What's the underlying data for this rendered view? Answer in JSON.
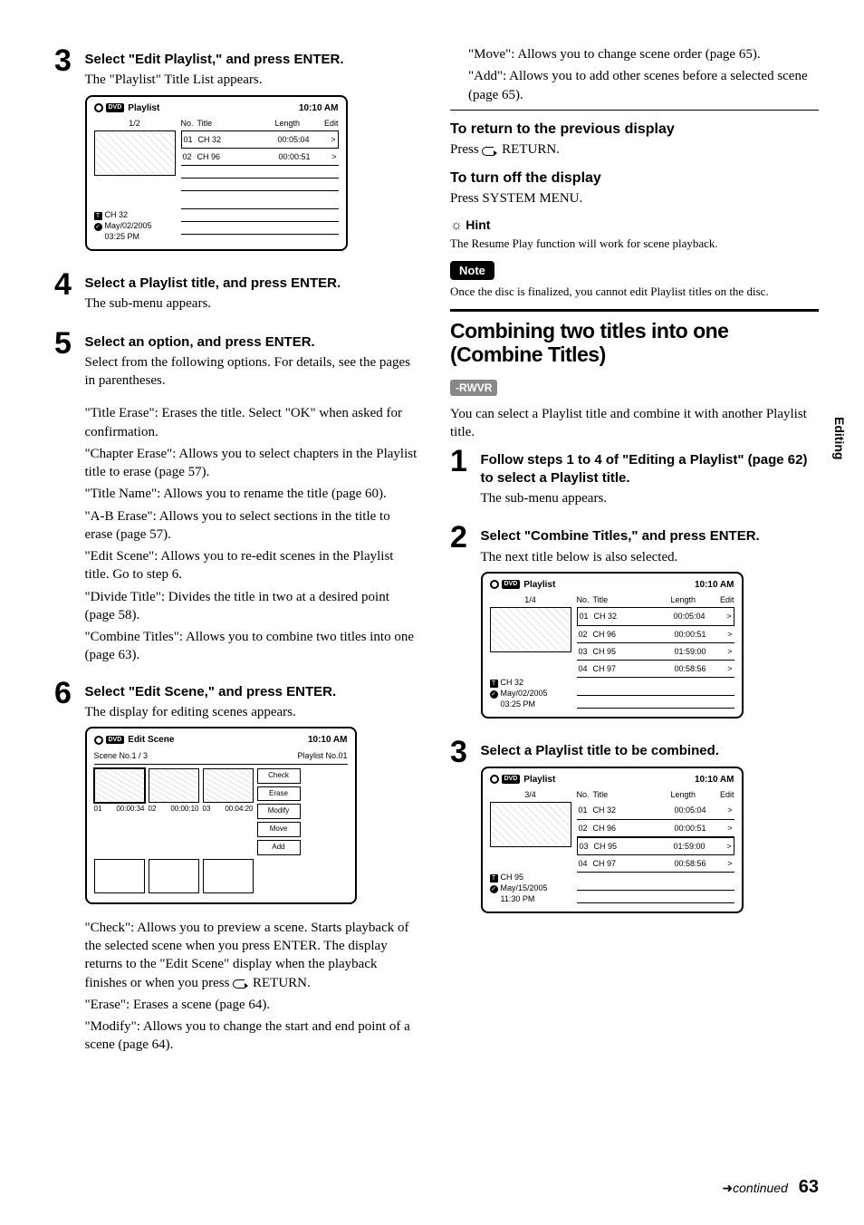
{
  "sidetab": "Editing",
  "footer": {
    "continued": "continued",
    "page": "63",
    "arrow": "➜"
  },
  "left": {
    "step3": {
      "num": "3",
      "head": "Select \"Edit Playlist,\" and press ENTER.",
      "sub": "The \"Playlist\" Title List appears."
    },
    "screen1": {
      "title": "Playlist",
      "time": "10:10 AM",
      "count": "1/2",
      "cols": [
        "No.",
        "Title",
        "Length",
        "Edit"
      ],
      "rows": [
        {
          "no": "01",
          "title": "CH 32",
          "len": "00:05:04",
          "edit": ">",
          "sel": true
        },
        {
          "no": "02",
          "title": "CH 96",
          "len": "00:00:51",
          "edit": ">"
        }
      ],
      "meta_ch": "CH 32",
      "meta_date": "May/02/2005",
      "meta_time": "03:25  PM"
    },
    "step4": {
      "num": "4",
      "head": "Select a Playlist title, and press ENTER.",
      "sub": "The sub-menu appears."
    },
    "step5": {
      "num": "5",
      "head": "Select an option, and press ENTER.",
      "sub": "Select from the following options. For details, see the pages in parentheses.",
      "opts": [
        "\"Title Erase\": Erases the title. Select \"OK\" when asked for confirmation.",
        "\"Chapter Erase\": Allows you to select chapters in the Playlist title to erase (page 57).",
        "\"Title Name\": Allows you to rename the title (page 60).",
        "\"A-B Erase\": Allows you to select sections in the title to erase (page 57).",
        "\"Edit Scene\": Allows you to re-edit scenes in the Playlist title. Go to step 6.",
        "\"Divide Title\": Divides the title in two at a desired point (page 58).",
        "\"Combine Titles\": Allows you to combine two titles into one (page 63)."
      ]
    },
    "step6": {
      "num": "6",
      "head": "Select \"Edit Scene,\" and press ENTER.",
      "sub": "The display for editing scenes appears."
    },
    "editScene": {
      "title": "Edit Scene",
      "time": "10:10 AM",
      "top_left": "Scene No.1 / 3",
      "top_right": "Playlist No.01",
      "cells": [
        {
          "no": "01",
          "t": "00:00:34",
          "sel": true
        },
        {
          "no": "02",
          "t": "00:00:10"
        },
        {
          "no": "03",
          "t": "00:04:20"
        }
      ],
      "side": [
        "Check",
        "Erase",
        "Modify",
        "Move",
        "Add"
      ]
    },
    "afterES": [
      "\"Check\": Allows you to preview a scene. Starts playback of the selected scene when you press ENTER. The display returns to the \"Edit Scene\" display when the playback finishes or when you press  RETURN.",
      "\"Erase\": Erases a scene (page 64).",
      "\"Modify\": Allows you to change the start and end point of a scene (page 64)."
    ]
  },
  "right": {
    "topParas": [
      "\"Move\": Allows you to change scene order (page 65).",
      "\"Add\": Allows you to add other scenes before a selected scene (page 65)."
    ],
    "ret_head": "To return to the previous display",
    "ret_body_pre": "Press ",
    "ret_body_post": " RETURN.",
    "off_head": "To turn off the display",
    "off_body": "Press SYSTEM MENU.",
    "hint_icon": "☼",
    "hint_label": "Hint",
    "hint_body": "The Resume Play function will work for scene playback.",
    "note_label": "Note",
    "note_body": "Once the disc is finalized, you cannot edit Playlist titles on the disc.",
    "section_head": "Combining two titles into one (Combine Titles)",
    "badge": "-RWVR",
    "intro": "You can select a Playlist title and combine it with another Playlist title.",
    "rstep1": {
      "num": "1",
      "head": "Follow steps 1 to 4 of \"Editing a Playlist\" (page 62) to select a Playlist title.",
      "sub": "The sub-menu appears."
    },
    "rstep2": {
      "num": "2",
      "head": "Select \"Combine Titles,\" and press ENTER.",
      "sub": "The next title below is also selected."
    },
    "screen2": {
      "title": "Playlist",
      "time": "10:10 AM",
      "count": "1/4",
      "cols": [
        "No.",
        "Title",
        "Length",
        "Edit"
      ],
      "rows": [
        {
          "no": "01",
          "title": "CH 32",
          "len": "00:05:04",
          "edit": ">",
          "sel": true
        },
        {
          "no": "02",
          "title": "CH 96",
          "len": "00:00:51",
          "edit": ">"
        },
        {
          "no": "03",
          "title": "CH 95",
          "len": "01:59:00",
          "edit": ">"
        },
        {
          "no": "04",
          "title": "CH 97",
          "len": "00:58:56",
          "edit": ">"
        }
      ],
      "meta_ch": "CH 32",
      "meta_date": "May/02/2005",
      "meta_time": "03:25  PM"
    },
    "rstep3": {
      "num": "3",
      "head": "Select a Playlist title to be combined."
    },
    "screen3": {
      "title": "Playlist",
      "time": "10:10 AM",
      "count": "3/4",
      "cols": [
        "No.",
        "Title",
        "Length",
        "Edit"
      ],
      "rows": [
        {
          "no": "01",
          "title": "CH 32",
          "len": "00:05:04",
          "edit": ">"
        },
        {
          "no": "02",
          "title": "CH 96",
          "len": "00:00:51",
          "edit": ">"
        },
        {
          "no": "03",
          "title": "CH 95",
          "len": "01:59:00",
          "edit": ">",
          "sel": true
        },
        {
          "no": "04",
          "title": "CH 97",
          "len": "00:58:56",
          "edit": ">"
        }
      ],
      "meta_ch": "CH 95",
      "meta_date": "May/15/2005",
      "meta_time": "11:30  PM"
    }
  }
}
